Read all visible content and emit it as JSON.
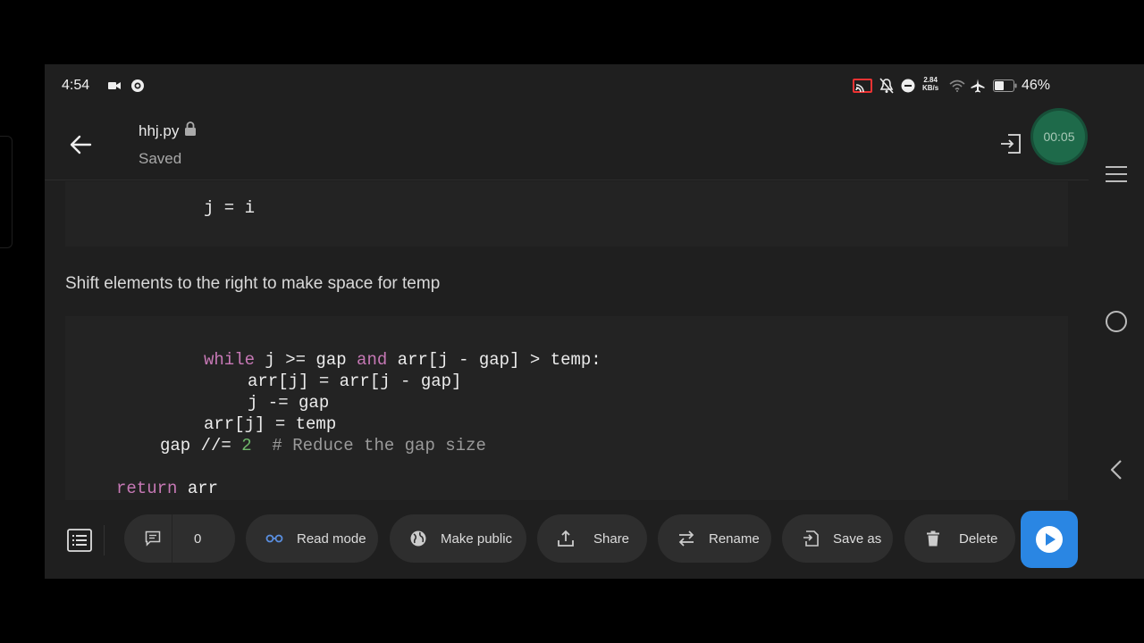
{
  "status_bar": {
    "time": "4:54",
    "speed_value": "2.84",
    "speed_unit": "KB/s",
    "battery": "46%"
  },
  "header": {
    "file_name": "hhj.py",
    "save_status": "Saved",
    "timer": "00:05"
  },
  "content": {
    "code_block_1": [
      "        j = i"
    ],
    "markdown_text": "Shift elements to the right to make space for temp",
    "code_block_2": {
      "line1_kw_while": "while",
      "line1_a": " j >= gap ",
      "line1_kw_and": "and",
      "line1_b": " arr[j - gap] > temp:",
      "line2": "arr[j] = arr[j - gap]",
      "line3": "j -= gap",
      "line4": "arr[j] = temp",
      "line5_a": "gap //= ",
      "line5_num": "2",
      "line5_comment": "  # Reduce the gap size",
      "line6_kw": "return",
      "line6_b": " arr"
    }
  },
  "toolbar": {
    "comments_count": "0",
    "read_mode": "Read mode",
    "make_public": "Make public",
    "share": "Share",
    "rename": "Rename",
    "save_as": "Save as",
    "delete": "Delete"
  },
  "colors": {
    "background": "#1f1f1f",
    "code_bg": "#232323",
    "keyword": "#c678b5",
    "number": "#6fb76b",
    "run_button": "#2a86e3",
    "timer_bubble": "#1e6a4a"
  },
  "icons": [
    "video-icon",
    "vpn-icon",
    "cast-icon",
    "mute-icon",
    "dnd-icon",
    "wifi-icon",
    "airplane-icon",
    "battery-icon",
    "back-arrow-icon",
    "lock-icon",
    "exit-icon",
    "menu-icon",
    "home-circle-icon",
    "back-chevron-icon",
    "toc-icon",
    "comment-icon",
    "glasses-icon",
    "globe-icon",
    "share-icon",
    "swap-icon",
    "save-as-icon",
    "trash-icon",
    "play-icon"
  ]
}
